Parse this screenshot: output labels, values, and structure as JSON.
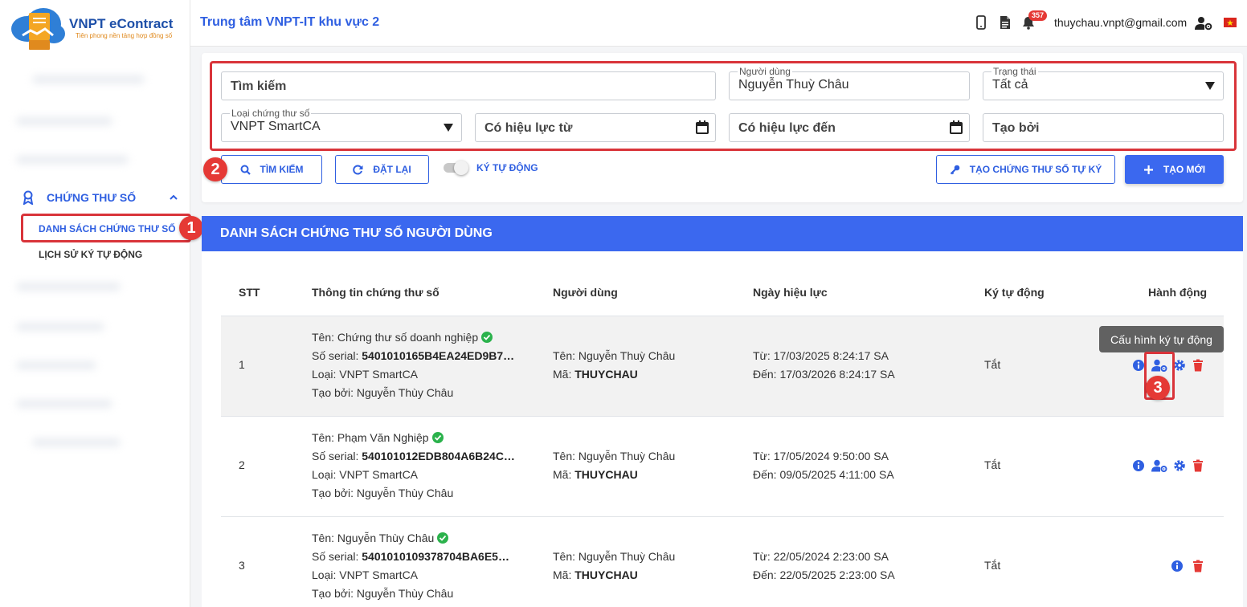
{
  "brand": {
    "title": "VNPT eContract",
    "tagline": "Tiên phong nền tảng hợp đồng số"
  },
  "header": {
    "org_name": "Trung tâm VNPT-IT khu vực 2",
    "notification_count": "357",
    "user_email": "thuychau.vnpt@gmail.com",
    "icons": [
      "mobile-icon",
      "document-icon",
      "bell-icon",
      "user-settings-icon",
      "vietnam-flag-icon"
    ]
  },
  "sidebar": {
    "section_label": "CHỨNG THƯ SỐ",
    "items": [
      {
        "label": "DANH SÁCH CHỨNG THƯ SỐ",
        "active": true
      },
      {
        "label": "LỊCH SỬ KÝ TỰ ĐỘNG",
        "active": false
      }
    ]
  },
  "filters": {
    "search": {
      "placeholder": "Tìm kiếm"
    },
    "user": {
      "label": "Người dùng",
      "value": "Nguyễn Thuỳ Châu"
    },
    "status": {
      "label": "Trạng thái",
      "value": "Tất cả"
    },
    "cert_type": {
      "label": "Loại chứng thư số",
      "value": "VNPT SmartCA"
    },
    "valid_from": {
      "placeholder": "Có hiệu lực từ"
    },
    "valid_to": {
      "placeholder": "Có hiệu lực đến"
    },
    "created_by": {
      "placeholder": "Tạo bởi"
    }
  },
  "actions": {
    "search_label": "TÌM KIẾM",
    "reset_label": "ĐẶT LẠI",
    "auto_sign_label": "KÝ TỰ ĐỘNG",
    "auto_sign_on": false,
    "create_self_signed_label": "TẠO CHỨNG THƯ SỐ TỰ KÝ",
    "create_new_label": "TẠO MỚI"
  },
  "markers": [
    "1",
    "2",
    "3"
  ],
  "table": {
    "title": "DANH SÁCH CHỨNG THƯ SỐ NGƯỜI DÙNG",
    "columns": [
      "STT",
      "Thông tin chứng thư số",
      "Người dùng",
      "Ngày hiệu lực",
      "Ký tự động",
      "Hành động"
    ],
    "tooltip": "Cấu hình ký tự động",
    "rows": [
      {
        "stt": "1",
        "name_label": "Tên:",
        "name": "Chứng thư số doanh nghiệp",
        "serial_label": "Số serial:",
        "serial": "5401010165B4EA24ED9B7…",
        "type_label": "Loại:",
        "type": "VNPT SmartCA",
        "created_label": "Tạo bởi:",
        "created_by": "Nguyễn Thùy Châu",
        "user_name_label": "Tên:",
        "user_name": "Nguyễn Thuỳ Châu",
        "user_code_label": "Mã:",
        "user_code": "THUYCHAU",
        "from_label": "Từ:",
        "from": "17/03/2025 8:24:17 SA",
        "to_label": "Đến:",
        "to": "17/03/2026 8:24:17 SA",
        "auto_sign": "Tắt"
      },
      {
        "stt": "2",
        "name_label": "Tên:",
        "name": "Phạm Văn Nghiệp",
        "serial_label": "Số serial:",
        "serial": "540101012EDB804A6B24C…",
        "type_label": "Loại:",
        "type": "VNPT SmartCA",
        "created_label": "Tạo bởi:",
        "created_by": "Nguyễn Thùy Châu",
        "user_name_label": "Tên:",
        "user_name": "Nguyễn Thuỳ Châu",
        "user_code_label": "Mã:",
        "user_code": "THUYCHAU",
        "from_label": "Từ:",
        "from": "17/05/2024 9:50:00 SA",
        "to_label": "Đến:",
        "to": "09/05/2025 4:11:00 SA",
        "auto_sign": "Tắt"
      },
      {
        "stt": "3",
        "name_label": "Tên:",
        "name": "Nguyễn Thùy Châu",
        "serial_label": "Số serial:",
        "serial": "5401010109378704BA6E5…",
        "type_label": "Loại:",
        "type": "VNPT SmartCA",
        "created_label": "Tạo bởi:",
        "created_by": "Nguyễn Thùy Châu",
        "user_name_label": "Tên:",
        "user_name": "Nguyễn Thuỳ Châu",
        "user_code_label": "Mã:",
        "user_code": "THUYCHAU",
        "from_label": "Từ:",
        "from": "22/05/2024 2:23:00 SA",
        "to_label": "Đến:",
        "to": "22/05/2025 2:23:00 SA",
        "auto_sign": "Tắt"
      }
    ]
  },
  "colors": {
    "primary": "#3b68ef",
    "highlight_red": "#d9343a",
    "delete_red": "#e53935",
    "check_green": "#2bb24c"
  }
}
